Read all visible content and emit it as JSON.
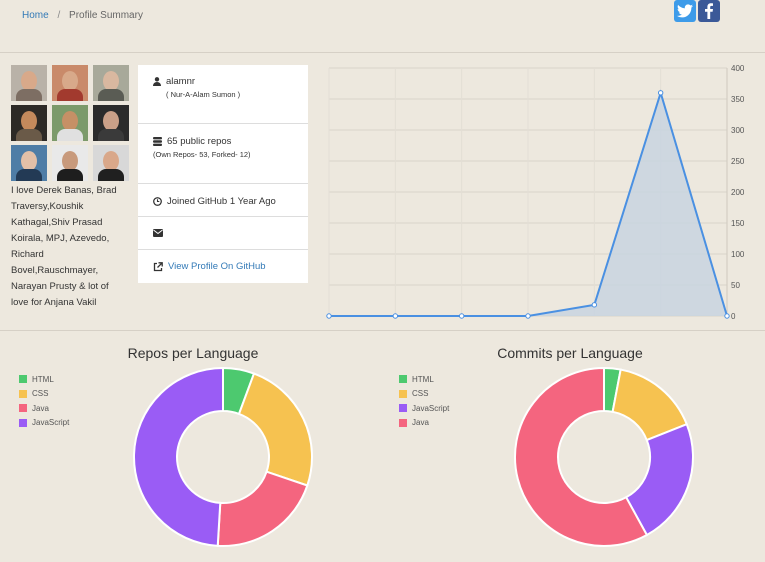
{
  "breadcrumb": {
    "home": "Home",
    "separator": "/",
    "current": "Profile Summary"
  },
  "social": {
    "twitter_icon": "twitter-icon",
    "facebook_icon": "facebook-icon"
  },
  "bio": "I love Derek Banas, Brad Traversy,Koushik Kathagal,Shiv Prasad Koirala, MPJ, Azevedo, Richard Bovel,Rauschmayer, Narayan Prusty & lot of love for Anjana Vakil",
  "profile": {
    "username": "alamnr",
    "fullname": "( Nur-A-Alam Sumon )",
    "repos": "65 public repos",
    "repos_detail": "(Own Repos- 53, Forked- 12)",
    "joined": "Joined GitHub 1 Year Ago",
    "email": "",
    "view_link": "View Profile On GitHub"
  },
  "chart_data": [
    {
      "type": "area",
      "x": [
        1,
        2,
        3,
        4,
        5,
        6,
        7
      ],
      "values": [
        0,
        0,
        0,
        0,
        18,
        360,
        0
      ],
      "ylim": [
        0,
        400
      ],
      "yticks": [
        0,
        50,
        100,
        150,
        200,
        250,
        300,
        350,
        400
      ],
      "grid": true,
      "colors": {
        "line": "#4a90e2",
        "fill": "#c8d3e0"
      }
    },
    {
      "type": "pie",
      "variant": "doughnut",
      "title": "Repos per Language",
      "labels": [
        "HTML",
        "CSS",
        "Java",
        "JavaScript"
      ],
      "values": [
        3,
        13,
        11,
        26
      ],
      "colors": [
        "#4dc96f",
        "#f6c250",
        "#f4657f",
        "#9a5cf5"
      ],
      "legend_position": "top-left"
    },
    {
      "type": "pie",
      "variant": "doughnut",
      "title": "Commits per Language",
      "labels": [
        "HTML",
        "CSS",
        "JavaScript",
        "Java"
      ],
      "values": [
        3,
        16,
        23,
        58
      ],
      "colors": [
        "#4dc96f",
        "#f6c250",
        "#9a5cf5",
        "#f4657f"
      ],
      "legend_position": "top-left"
    }
  ]
}
